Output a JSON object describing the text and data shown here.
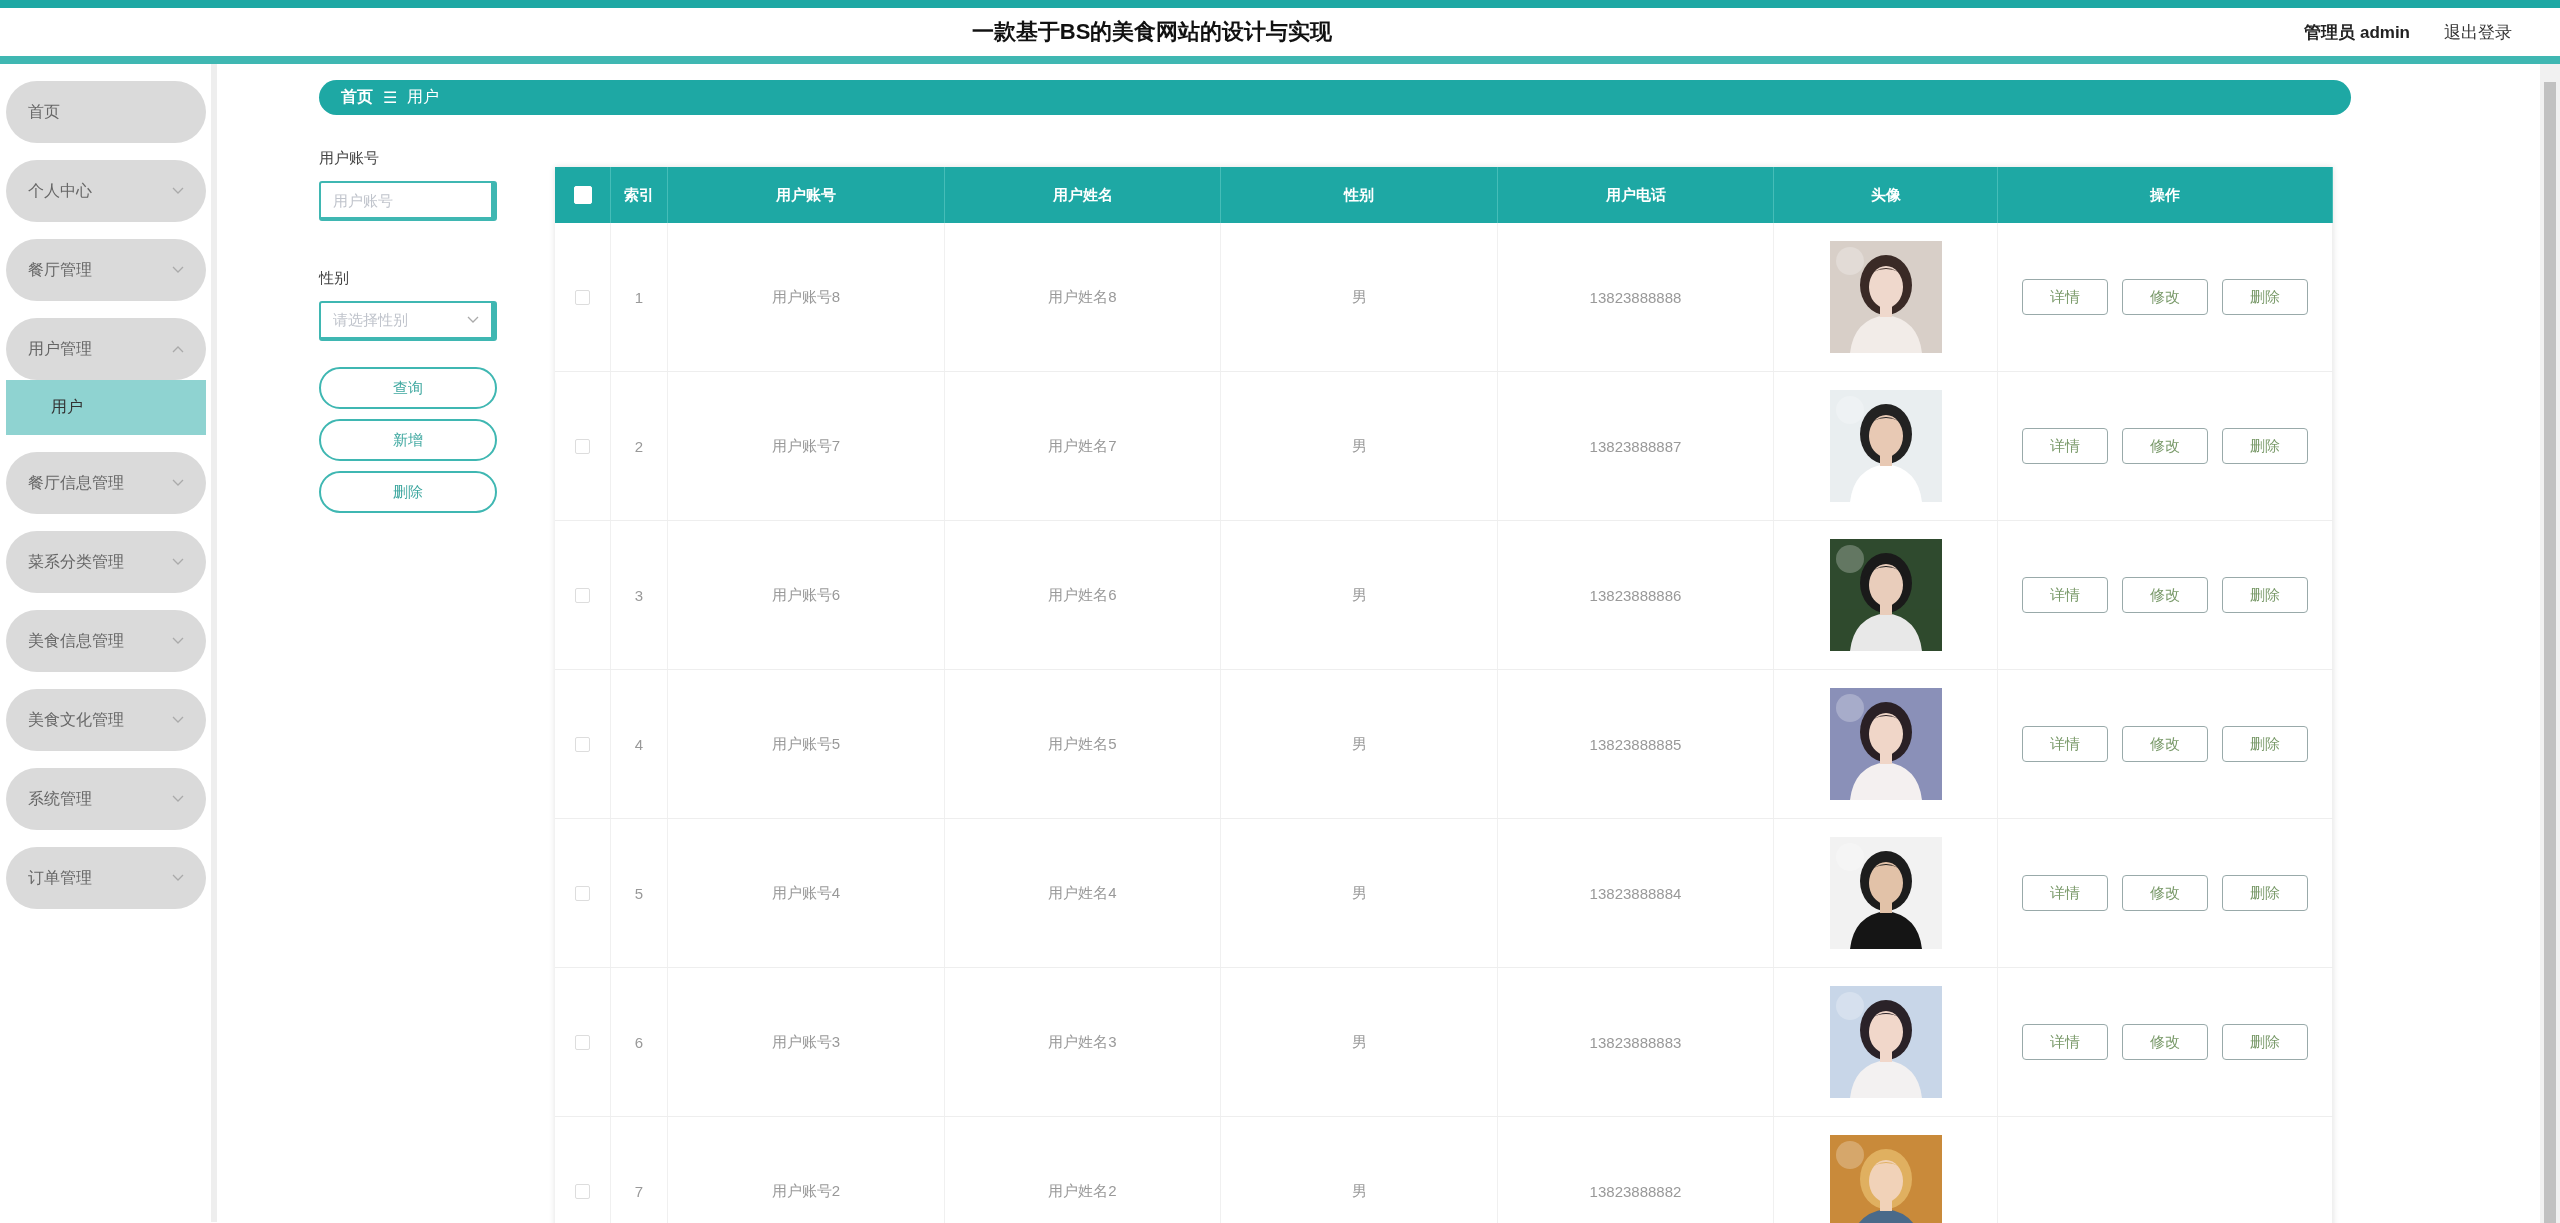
{
  "header": {
    "title": "一款基于BS的美食网站的设计与实现",
    "user": "管理员 admin",
    "logout": "退出登录"
  },
  "sidebar": {
    "items": [
      {
        "label": "首页",
        "kind": "link"
      },
      {
        "label": "个人中心",
        "kind": "group",
        "expanded": false
      },
      {
        "label": "餐厅管理",
        "kind": "group",
        "expanded": false
      },
      {
        "label": "用户管理",
        "kind": "group",
        "expanded": true,
        "children": [
          {
            "label": "用户",
            "selected": true
          }
        ]
      },
      {
        "label": "餐厅信息管理",
        "kind": "group",
        "expanded": false
      },
      {
        "label": "菜系分类管理",
        "kind": "group",
        "expanded": false
      },
      {
        "label": "美食信息管理",
        "kind": "group",
        "expanded": false
      },
      {
        "label": "美食文化管理",
        "kind": "group",
        "expanded": false
      },
      {
        "label": "系统管理",
        "kind": "group",
        "expanded": false
      },
      {
        "label": "订单管理",
        "kind": "group",
        "expanded": false
      }
    ]
  },
  "breadcrumb": {
    "items": [
      "首页",
      "用户"
    ],
    "separator": "☰"
  },
  "search": {
    "fields": [
      {
        "label": "用户账号",
        "placeholder": "用户账号",
        "kind": "text"
      },
      {
        "label": "性别",
        "placeholder": "请选择性别",
        "kind": "select"
      }
    ],
    "buttons": [
      "查询",
      "新增",
      "删除"
    ]
  },
  "table": {
    "select_all": {
      "checked": false
    },
    "columns": [
      "索引",
      "用户账号",
      "用户姓名",
      "性别",
      "用户电话",
      "头像",
      "操作"
    ],
    "rows": [
      {
        "checked": false,
        "cells": [
          "1",
          "用户账号8",
          "用户姓名8",
          "男",
          "13823888888"
        ],
        "actions": [
          "详情",
          "修改",
          "删除"
        ]
      },
      {
        "checked": false,
        "cells": [
          "2",
          "用户账号7",
          "用户姓名7",
          "男",
          "13823888887"
        ],
        "actions": [
          "详情",
          "修改",
          "删除"
        ]
      },
      {
        "checked": false,
        "cells": [
          "3",
          "用户账号6",
          "用户姓名6",
          "男",
          "13823888886"
        ],
        "actions": [
          "详情",
          "修改",
          "删除"
        ]
      },
      {
        "checked": false,
        "cells": [
          "4",
          "用户账号5",
          "用户姓名5",
          "男",
          "13823888885"
        ],
        "actions": [
          "详情",
          "修改",
          "删除"
        ]
      },
      {
        "checked": false,
        "cells": [
          "5",
          "用户账号4",
          "用户姓名4",
          "男",
          "13823888884"
        ],
        "actions": [
          "详情",
          "修改",
          "删除"
        ]
      },
      {
        "checked": false,
        "cells": [
          "6",
          "用户账号3",
          "用户姓名3",
          "男",
          "13823888883"
        ],
        "actions": [
          "详情",
          "修改",
          "删除"
        ]
      },
      {
        "checked": false,
        "cells": [
          "7",
          "用户账号2",
          "用户姓名2",
          "男",
          "13823888882"
        ]
      }
    ]
  }
}
